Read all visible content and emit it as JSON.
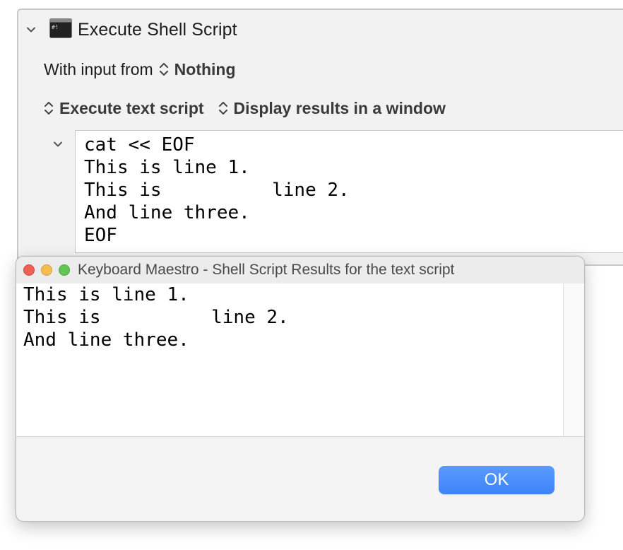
{
  "action": {
    "title": "Execute Shell Script",
    "icon": "terminal-script-icon",
    "input_label": "With input from",
    "input_value": "Nothing",
    "execute_option": "Execute text script",
    "display_option": "Display results in a window",
    "script": "cat << EOF\nThis is line 1.\nThis is          line 2.\nAnd line three.\nEOF"
  },
  "results_window": {
    "title": "Keyboard Maestro - Shell Script Results for the text script",
    "output": "This is line 1.\nThis is          line 2.\nAnd line three.",
    "ok_label": "OK"
  },
  "colors": {
    "accent_button": "#3d83f7",
    "close": "#ee5f57",
    "minimize": "#f5bd4f",
    "maximize": "#62c555"
  }
}
